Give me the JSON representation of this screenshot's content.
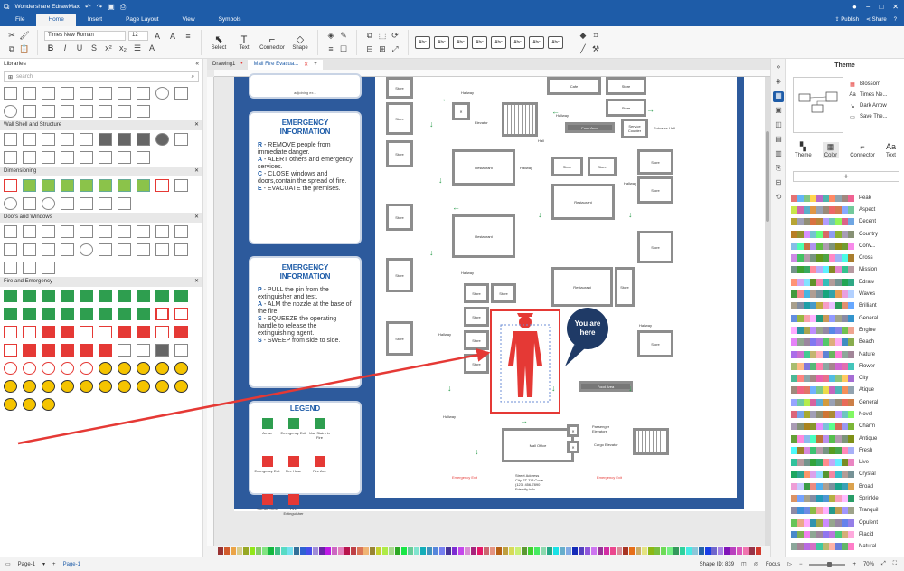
{
  "app": {
    "title": "Wondershare EdrawMax",
    "publish": "Publish",
    "share": "Share",
    "help": "?"
  },
  "menu": [
    "File",
    "Home",
    "Insert",
    "Page Layout",
    "View",
    "Symbols"
  ],
  "ribbon": {
    "font_name": "Times New Roman",
    "font_size": "12",
    "select": "Select",
    "text": "Text",
    "connector": "Connector",
    "shape": "Shape",
    "style_labels": [
      "Abc",
      "Abc",
      "Abc",
      "Abc",
      "Abc",
      "Abc",
      "Abc",
      "Abc"
    ]
  },
  "libraries": {
    "title": "Libraries",
    "search_placeholder": "search",
    "sections": [
      "Wall Shell and Structure",
      "Dimensioning",
      "Doors and Windows",
      "Fire and Emergency"
    ]
  },
  "tabs": [
    {
      "label": "Drawing1"
    },
    {
      "label": "Mall Fire Evacua..."
    }
  ],
  "cards": {
    "top_fragment": "adjoining ex...",
    "card1": {
      "title": "EMERGENCY\nINFORMATION",
      "lines": [
        {
          "k": "R",
          "t": " - REMOVE people from immediate danger."
        },
        {
          "k": "A",
          "t": " - ALERT others and emergency services."
        },
        {
          "k": "C",
          "t": " - CLOSE windows and doors,contain the spread of fire."
        },
        {
          "k": "E",
          "t": " - EVACUATE the premises."
        }
      ]
    },
    "card2": {
      "title": "EMERGENCY\nINFORMATION",
      "lines": [
        {
          "k": "P",
          "t": " - PULL the pin from the extinguisher and test."
        },
        {
          "k": "A",
          "t": " - ALM the nozzle at the base of the fire."
        },
        {
          "k": "S",
          "t": " - SQUEEZE the operating handle to release the extinguishing agent."
        },
        {
          "k": "S",
          "t": " - SWEEP from side to side."
        }
      ]
    },
    "legend": {
      "title": "LEGEND",
      "items": [
        "Arrow",
        "Emergency Exit",
        "Use Stairs in Fire",
        "Emergency Exit",
        "Fire Hose",
        "Fire Axe",
        "You are Here",
        "Fire Extinguisher"
      ]
    }
  },
  "floorplan": {
    "labels": [
      "Store",
      "Store",
      "Cafe",
      "Store",
      "Hallway",
      "Elevator",
      "Hallway",
      "Store",
      "Store",
      "Food Area",
      "Service Counter",
      "Entrance Hall",
      "Hall",
      "Restaurant",
      "Hallway",
      "Store",
      "Store",
      "Store",
      "Hallway",
      "Restaurant",
      "Store",
      "Store",
      "Restaurant",
      "Hallway",
      "Store",
      "Restaurant",
      "Store",
      "Store",
      "Store",
      "Store",
      "Store",
      "Store",
      "Hallway",
      "Store",
      "Store",
      "Store",
      "Food Area",
      "Hallway",
      "Mall Office",
      "Passenger Elevators",
      "Cargo Elevator",
      "Emergency Exit",
      "Emergency Exit",
      "Hallway"
    ],
    "you_are_here": "You are\nhere",
    "address_lines": [
      "Street Address",
      "City ST ZIP Code",
      "(123) 456-7890",
      "Friendly info"
    ]
  },
  "theme": {
    "title": "Theme",
    "options": [
      "Blossom",
      "Times Ne...",
      "Dark Arrow",
      "Save The..."
    ],
    "subtabs": [
      "Theme",
      "Color",
      "Connector",
      "Text"
    ],
    "add": "+",
    "palettes": [
      "Peak",
      "Aspect",
      "Decent",
      "Country",
      "Conv...",
      "Cross",
      "Mission",
      "Edraw",
      "Waves",
      "Brilliant",
      "General",
      "Engine",
      "Beach",
      "Nature",
      "Flower",
      "City",
      "Atique",
      "General",
      "Novel",
      "Charm",
      "Antique",
      "Fresh",
      "Live",
      "Crystal",
      "Broad",
      "Sprinkle",
      "Tranquil",
      "Opulent",
      "Placid",
      "Natural"
    ]
  },
  "status": {
    "page_select": "Page-1",
    "page_tab": "Page-1",
    "shape_id": "Shape ID: 839",
    "focus": "Focus",
    "zoom": "70%"
  },
  "colors": {
    "brand": "#1e5ca8",
    "frame": "#2d5a9c",
    "red": "#e53935",
    "green": "#2e9e4f"
  }
}
